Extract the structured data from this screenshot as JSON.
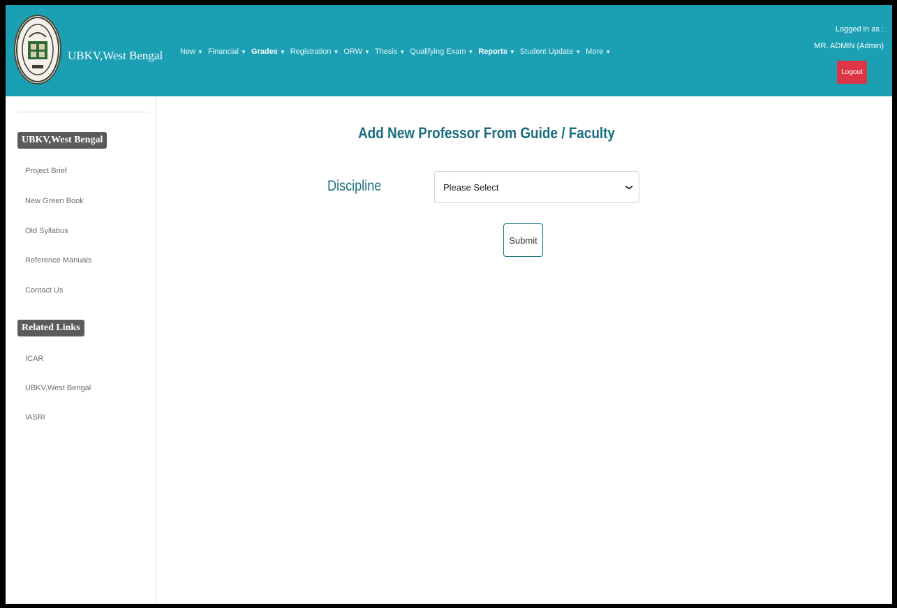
{
  "header": {
    "brand": "UBKV,West Bengal",
    "nav": [
      {
        "label": "New",
        "bold": false
      },
      {
        "label": "Financial",
        "bold": false
      },
      {
        "label": "Grades",
        "bold": false
      },
      {
        "label": "Registration",
        "bold": false
      },
      {
        "label": "ORW",
        "bold": false
      },
      {
        "label": "Thesis",
        "bold": false
      },
      {
        "label": "Qualifying Exam",
        "bold": false
      },
      {
        "label": "Reports",
        "bold": true
      },
      {
        "label": "Student Update",
        "bold": false
      },
      {
        "label": "More",
        "bold": false
      }
    ],
    "logged_in_as": "Logged in as :",
    "user": "MR. ADMIN (Admin)",
    "logout_label": "Logout"
  },
  "sidebar": {
    "section1_title": "UBKV,West Bengal",
    "section1_links": [
      "Project Brief",
      "New Green Book",
      "Old Syllabus",
      "Reference Manuals",
      "Contact Us"
    ],
    "section2_title": "Related Links",
    "section2_links": [
      "ICAR",
      "UBKV,West Bengal",
      "IASRI"
    ]
  },
  "main": {
    "title": "Add New Professor From Guide / Faculty",
    "discipline_label": "Discipline",
    "discipline_value": "Please Select",
    "submit_label": "Submit"
  },
  "colors": {
    "header_bg": "#1a9fb3",
    "accent_text": "#1b6e7e",
    "logout_bg": "#dc3545",
    "badge_bg": "#5b5b5b"
  }
}
